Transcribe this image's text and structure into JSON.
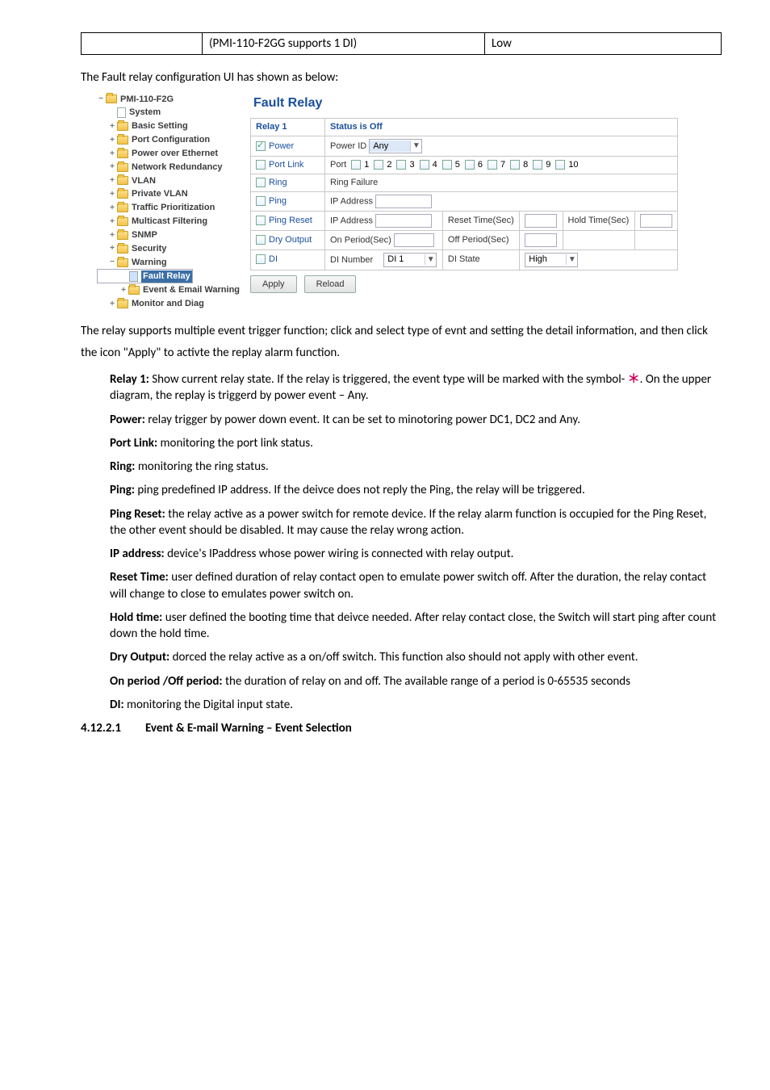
{
  "top_table": {
    "left": "(PMI-110-F2GG supports 1 DI)",
    "right": "Low"
  },
  "intro": "The Fault relay configuration UI has shown as below:",
  "tree": {
    "device": "PMI-110-F2G",
    "items": [
      "System",
      "Basic Setting",
      "Port Configuration",
      "Power over Ethernet",
      "Network Redundancy",
      "VLAN",
      "Private VLAN",
      "Traffic Prioritization",
      "Multicast Filtering",
      "SNMP",
      "Security",
      "Warning",
      "Fault Relay",
      "Event & Email Warning",
      "Monitor and Diag"
    ]
  },
  "panel": {
    "title": "Fault Relay",
    "relay_label": "Relay 1",
    "status_label": "Status is Off",
    "rows": {
      "power": {
        "label": "Power",
        "checked": true,
        "field": "Power ID",
        "value": "Any"
      },
      "portlink": {
        "label": "Port Link",
        "field": "Port",
        "ports": [
          "1",
          "2",
          "3",
          "4",
          "5",
          "6",
          "7",
          "8",
          "9",
          "10"
        ]
      },
      "ring": {
        "label": "Ring",
        "field": "Ring Failure"
      },
      "ping": {
        "label": "Ping",
        "field": "IP Address"
      },
      "pingreset": {
        "label": "Ping Reset",
        "field": "IP Address",
        "reset": "Reset Time(Sec)",
        "hold": "Hold Time(Sec)"
      },
      "dryoutput": {
        "label": "Dry Output",
        "on": "On Period(Sec)",
        "off": "Off Period(Sec)"
      },
      "di": {
        "label": "DI",
        "num": "DI Number",
        "numval": "DI 1",
        "state": "DI State",
        "stateval": "High"
      }
    },
    "buttons": {
      "apply": "Apply",
      "reload": "Reload"
    }
  },
  "para1": "The relay supports multiple event trigger function; click and select type of evnt and setting the detail information, and then click the icon \"Apply\" to activte the replay alarm function.",
  "relay1_a": "Relay 1:",
  "relay1_b": " Show current relay state. If the relay is triggered, the event type will be marked with the symbol- ",
  "relay1_c": ". On the upper diagram, the replay is triggerd by power event – Any.",
  "power_a": "Power:",
  "power_b": " relay trigger by power down event. It can be set to minotoring power DC1, DC2 and Any.",
  "portlink_a": "Port Link:",
  "portlink_b": " monitoring the port link status.",
  "ring_a": "Ring:",
  "ring_b": " monitoring the ring status.",
  "ping_a": "Ping:",
  "ping_b": " ping predefined IP address. If the deivce does not reply the Ping, the relay will be triggered.",
  "pingreset_a": "Ping Reset:",
  "pingreset_b": " the relay active as a power switch for remote device. If the relay alarm function is occupied for the Ping Reset, the other event should be disabled. It may cause the relay wrong action.",
  "ipaddr_a": "IP address:",
  "ipaddr_b": " device's IPaddress whose power wiring is connected with relay output.",
  "resettime_a": "Reset Time:",
  "resettime_b": " user defined duration of relay contact open to emulate power switch off. After the duration, the relay contact will change to close to emulates power switch on.",
  "holdtime_a": "Hold time:",
  "holdtime_b": " user defined the booting time that deivce needed. After relay contact close, the Switch will start ping after count down the hold time.",
  "dryoutput_a": "Dry Output:",
  "dryoutput_b": " dorced the relay active as a on/off switch. This function also should not apply with other event.",
  "onperiod_a": "On period /Off period:",
  "onperiod_b": " the duration of relay on and off. The available range of a period is 0-65535 seconds",
  "di_a": "DI:",
  "di_b": " monitoring the Digital input state.",
  "section": {
    "num": "4.12.2.1",
    "title": "Event & E-mail Warning – Event Selection"
  }
}
